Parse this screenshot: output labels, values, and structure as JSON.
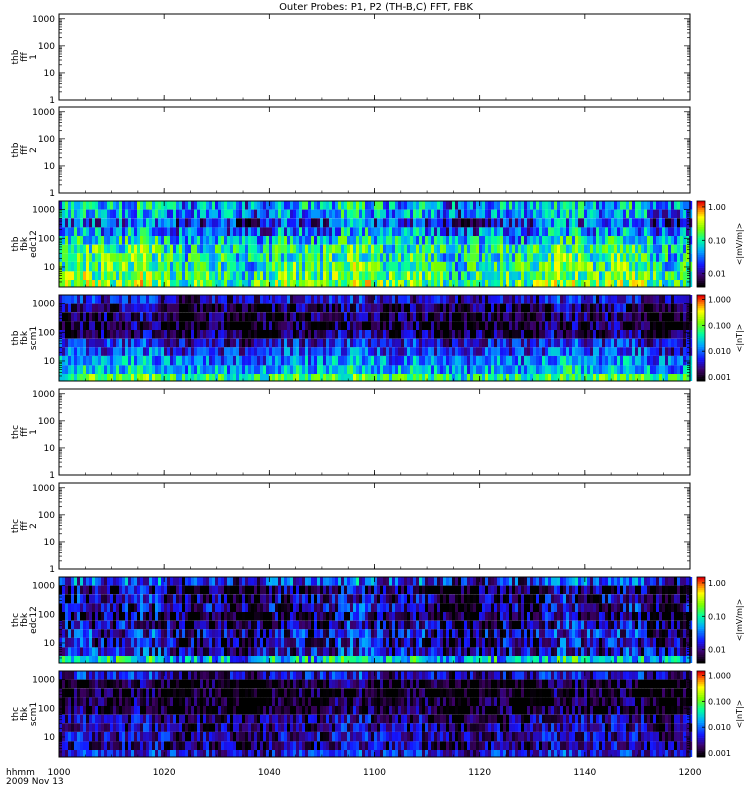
{
  "title": "Outer Probes: P1, P2 (TH-B,C) FFT, FBK",
  "time_axis": {
    "row_label": "hhmm",
    "date_label": "2009 Nov 13",
    "ticks": [
      "1000",
      "1020",
      "1040",
      "1100",
      "1120",
      "1140",
      "1200"
    ]
  },
  "chart_data": [
    {
      "type": "heatmap",
      "panel_label": [
        "thb",
        "fff",
        "1"
      ],
      "has_data": false,
      "yscale": "log",
      "ylim": [
        1,
        1500
      ],
      "y_ticks": [
        "1",
        "10",
        "100",
        "1000"
      ]
    },
    {
      "type": "heatmap",
      "panel_label": [
        "thb",
        "fff",
        "2"
      ],
      "has_data": false,
      "yscale": "log",
      "ylim": [
        1,
        1500
      ],
      "y_ticks": [
        "1",
        "10",
        "100",
        "1000"
      ]
    },
    {
      "type": "heatmap",
      "panel_label": [
        "thb",
        "fbk",
        "edc12"
      ],
      "has_data": true,
      "yscale": "log",
      "ylim": [
        2,
        2000
      ],
      "y_ticks": [
        "10",
        "100",
        "1000"
      ],
      "colorbar": {
        "label": "<|mV/m|>",
        "ticks": [
          "0.01",
          "0.10",
          "1.00"
        ],
        "range": [
          0.004,
          1.5
        ]
      },
      "bands": [
        {
          "ylo": 1000,
          "yhi": 2000,
          "level": 0.05
        },
        {
          "ylo": 500,
          "yhi": 1000,
          "level": 0.04
        },
        {
          "ylo": 240,
          "yhi": 500,
          "level": 0.02
        },
        {
          "ylo": 120,
          "yhi": 240,
          "level": 0.035
        },
        {
          "ylo": 60,
          "yhi": 120,
          "level": 0.06
        },
        {
          "ylo": 30,
          "yhi": 60,
          "level": 0.1
        },
        {
          "ylo": 15,
          "yhi": 30,
          "level": 0.1
        },
        {
          "ylo": 7,
          "yhi": 15,
          "level": 0.12
        },
        {
          "ylo": 3.5,
          "yhi": 7,
          "level": 0.14
        },
        {
          "ylo": 2,
          "yhi": 3.5,
          "level": 0.18
        }
      ]
    },
    {
      "type": "heatmap",
      "panel_label": [
        "thb",
        "fbk",
        "scm1"
      ],
      "has_data": true,
      "yscale": "log",
      "ylim": [
        2,
        2000
      ],
      "y_ticks": [
        "10",
        "100",
        "1000"
      ],
      "colorbar": {
        "label": "<|nT|>",
        "ticks": [
          "0.001",
          "0.010",
          "0.100",
          "1.000"
        ],
        "range": [
          0.0007,
          1.5
        ]
      },
      "bands": [
        {
          "ylo": 1000,
          "yhi": 2000,
          "level": 0.003
        },
        {
          "ylo": 500,
          "yhi": 1000,
          "level": 0.0015
        },
        {
          "ylo": 240,
          "yhi": 500,
          "level": 0.0012
        },
        {
          "ylo": 120,
          "yhi": 240,
          "level": 0.001
        },
        {
          "ylo": 60,
          "yhi": 120,
          "level": 0.0015
        },
        {
          "ylo": 30,
          "yhi": 60,
          "level": 0.004
        },
        {
          "ylo": 15,
          "yhi": 30,
          "level": 0.006
        },
        {
          "ylo": 7,
          "yhi": 15,
          "level": 0.012
        },
        {
          "ylo": 3.5,
          "yhi": 7,
          "level": 0.02
        },
        {
          "ylo": 2,
          "yhi": 3.5,
          "level": 0.06
        }
      ]
    },
    {
      "type": "heatmap",
      "panel_label": [
        "thc",
        "fff",
        "1"
      ],
      "has_data": false,
      "yscale": "log",
      "ylim": [
        1,
        1500
      ],
      "y_ticks": [
        "1",
        "10",
        "100",
        "1000"
      ]
    },
    {
      "type": "heatmap",
      "panel_label": [
        "thc",
        "fff",
        "2"
      ],
      "has_data": false,
      "yscale": "log",
      "ylim": [
        1,
        1500
      ],
      "y_ticks": [
        "1",
        "10",
        "100",
        "1000"
      ]
    },
    {
      "type": "heatmap",
      "panel_label": [
        "thc",
        "fbk",
        "edc12"
      ],
      "has_data": true,
      "yscale": "log",
      "ylim": [
        2,
        2000
      ],
      "y_ticks": [
        "10",
        "100",
        "1000"
      ],
      "colorbar": {
        "label": "<|mV/m|>",
        "ticks": [
          "0.01",
          "0.10",
          "1.00"
        ],
        "range": [
          0.004,
          1.5
        ]
      },
      "bands": [
        {
          "ylo": 1000,
          "yhi": 2000,
          "level": 0.02
        },
        {
          "ylo": 500,
          "yhi": 1000,
          "level": 0.006
        },
        {
          "ylo": 240,
          "yhi": 500,
          "level": 0.008
        },
        {
          "ylo": 120,
          "yhi": 240,
          "level": 0.01
        },
        {
          "ylo": 60,
          "yhi": 120,
          "level": 0.007
        },
        {
          "ylo": 30,
          "yhi": 60,
          "level": 0.009
        },
        {
          "ylo": 15,
          "yhi": 30,
          "level": 0.012
        },
        {
          "ylo": 7,
          "yhi": 15,
          "level": 0.01
        },
        {
          "ylo": 3.5,
          "yhi": 7,
          "level": 0.012
        },
        {
          "ylo": 2,
          "yhi": 3.5,
          "level": 0.06
        }
      ]
    },
    {
      "type": "heatmap",
      "panel_label": [
        "thc",
        "fbk",
        "scm1"
      ],
      "has_data": true,
      "yscale": "log",
      "ylim": [
        2,
        2000
      ],
      "y_ticks": [
        "10",
        "100",
        "1000"
      ],
      "colorbar": {
        "label": "<|nT|>",
        "ticks": [
          "0.001",
          "0.010",
          "0.100",
          "1.000"
        ],
        "range": [
          0.0007,
          1.5
        ]
      },
      "bands": [
        {
          "ylo": 1000,
          "yhi": 2000,
          "level": 0.003
        },
        {
          "ylo": 500,
          "yhi": 1000,
          "level": 0.0008
        },
        {
          "ylo": 240,
          "yhi": 500,
          "level": 0.0008
        },
        {
          "ylo": 120,
          "yhi": 240,
          "level": 0.0009
        },
        {
          "ylo": 60,
          "yhi": 120,
          "level": 0.001
        },
        {
          "ylo": 30,
          "yhi": 60,
          "level": 0.002
        },
        {
          "ylo": 15,
          "yhi": 30,
          "level": 0.002
        },
        {
          "ylo": 7,
          "yhi": 15,
          "level": 0.0025
        },
        {
          "ylo": 3.5,
          "yhi": 7,
          "level": 0.002
        },
        {
          "ylo": 2,
          "yhi": 3.5,
          "level": 0.004
        }
      ]
    }
  ]
}
